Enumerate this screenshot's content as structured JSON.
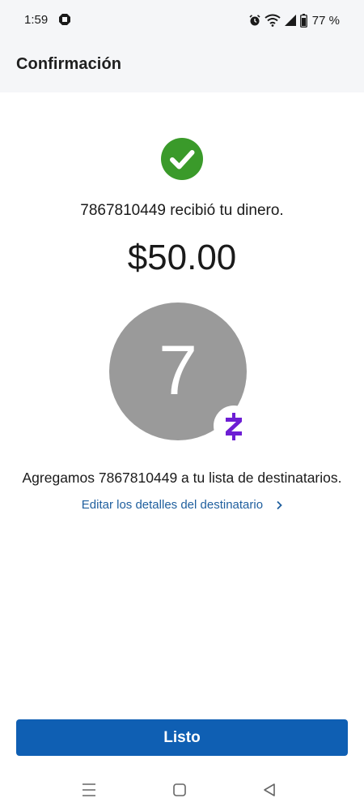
{
  "status_bar": {
    "time": "1:59",
    "battery": "77 %",
    "icons": [
      "chase-logo-icon",
      "alarm-icon",
      "wifi-icon",
      "signal-icon",
      "battery-icon"
    ]
  },
  "header": {
    "title": "Confirmación"
  },
  "confirmation": {
    "icon": "check-circle-icon",
    "received_text": "7867810449 recibió tu dinero.",
    "amount": "$50.00",
    "avatar_initial": "7",
    "badge_icon": "zelle-icon",
    "added_text": "Agregamos 7867810449 a tu lista de destinatarios.",
    "edit_link": "Editar los detalles del destinatario"
  },
  "footer": {
    "done_label": "Listo"
  },
  "nav": {
    "icons": [
      "menu-icon",
      "home-icon",
      "back-icon"
    ]
  },
  "colors": {
    "accent": "#0f5fb3",
    "success": "#3a9a2a",
    "zelle": "#6d1ed4",
    "link": "#1f5f9e",
    "avatar": "#9a9a9a",
    "header_bg": "#f5f6f8"
  }
}
